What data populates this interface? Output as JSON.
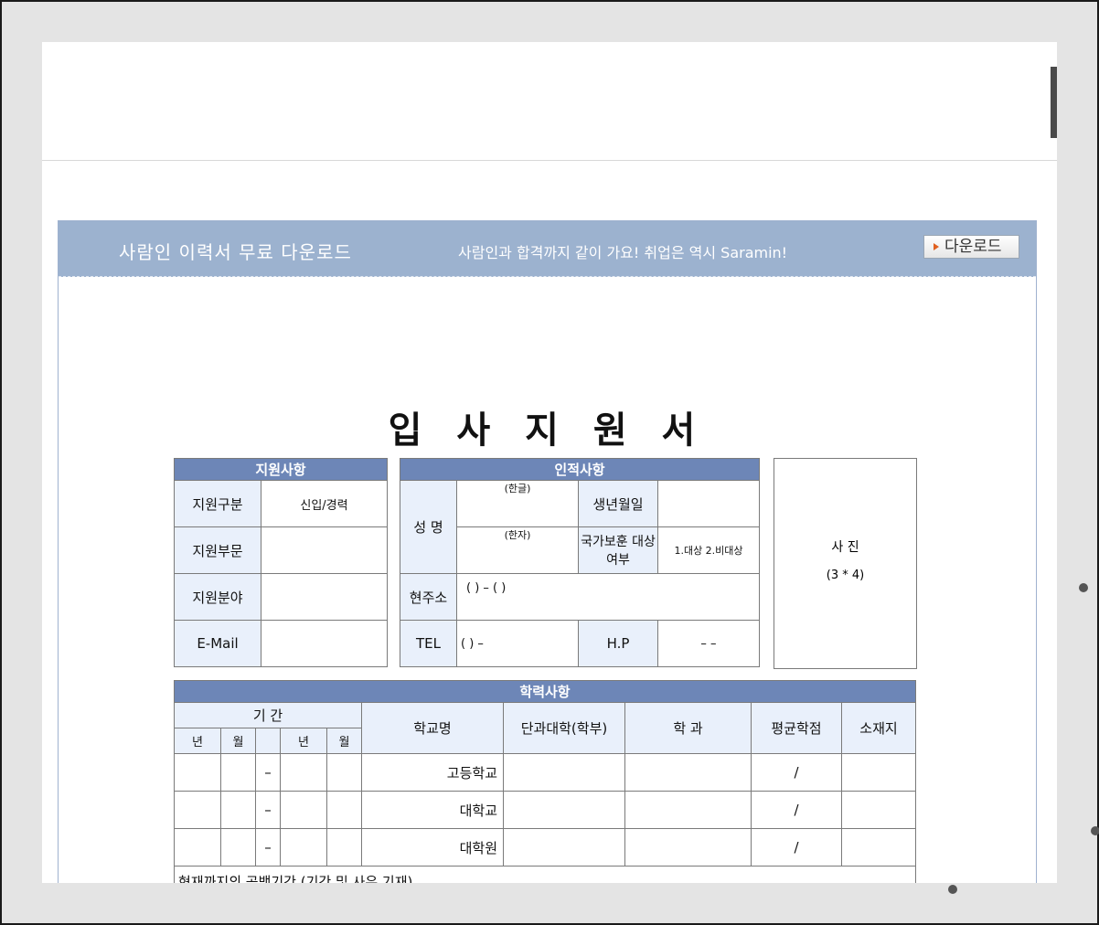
{
  "banner": {
    "title": "사람인 이력서 무료 다운로드",
    "subtitle": "사람인과 합격까지 같이 가요! 취업은 역시 Saramin!",
    "download_label": "다운로드"
  },
  "document": {
    "title": "입 사 지 원 서",
    "application": {
      "header": "지원사항",
      "rows": [
        {
          "label": "지원구분",
          "value": "신입/경력"
        },
        {
          "label": "지원부문",
          "value": ""
        },
        {
          "label": "지원분야",
          "value": ""
        },
        {
          "label": "E-Mail",
          "value": ""
        }
      ]
    },
    "personal": {
      "header": "인적사항",
      "name_label": "성 명",
      "hangul_note": "(한글)",
      "hanja_note": "(한자)",
      "birth_label": "생년월일",
      "veteran_label": "국가보훈 대상여부",
      "veteran_value": "1.대상 2.비대상",
      "address_label": "현주소",
      "address_value": "(      ) – (      )",
      "tel_label": "TEL",
      "tel_value": "(    )      –",
      "hp_label": "H.P",
      "hp_value": "–        –"
    },
    "photo": {
      "label": "사  진",
      "size": "(3 * 4)"
    },
    "education": {
      "header": "학력사항",
      "period_label": "기 간",
      "year_label": "년",
      "month_label": "월",
      "columns": [
        "학교명",
        "단과대학(학부)",
        "학 과",
        "평균학점",
        "소재지"
      ],
      "rows": [
        {
          "dash": "–",
          "school": "고등학교",
          "gpa": "/"
        },
        {
          "dash": "–",
          "school": "대학교",
          "gpa": "/"
        },
        {
          "dash": "–",
          "school": "대학원",
          "gpa": "/"
        }
      ],
      "footer_partial": "현재까지의 공백기간 (기간 및 사유 기재)"
    }
  }
}
